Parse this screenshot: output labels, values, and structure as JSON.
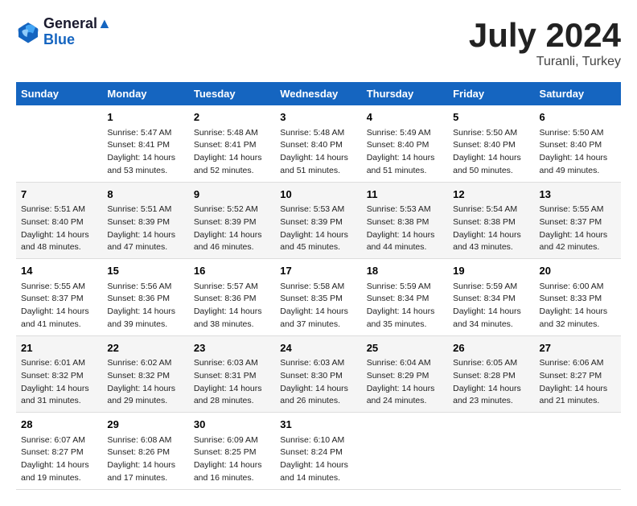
{
  "header": {
    "logo_line1": "General",
    "logo_line2": "Blue",
    "main_title": "July 2024",
    "subtitle": "Turanli, Turkey"
  },
  "columns": [
    "Sunday",
    "Monday",
    "Tuesday",
    "Wednesday",
    "Thursday",
    "Friday",
    "Saturday"
  ],
  "weeks": [
    [
      {
        "day": "",
        "sunrise": "",
        "sunset": "",
        "daylight": ""
      },
      {
        "day": "1",
        "sunrise": "Sunrise: 5:47 AM",
        "sunset": "Sunset: 8:41 PM",
        "daylight": "Daylight: 14 hours and 53 minutes."
      },
      {
        "day": "2",
        "sunrise": "Sunrise: 5:48 AM",
        "sunset": "Sunset: 8:41 PM",
        "daylight": "Daylight: 14 hours and 52 minutes."
      },
      {
        "day": "3",
        "sunrise": "Sunrise: 5:48 AM",
        "sunset": "Sunset: 8:40 PM",
        "daylight": "Daylight: 14 hours and 51 minutes."
      },
      {
        "day": "4",
        "sunrise": "Sunrise: 5:49 AM",
        "sunset": "Sunset: 8:40 PM",
        "daylight": "Daylight: 14 hours and 51 minutes."
      },
      {
        "day": "5",
        "sunrise": "Sunrise: 5:50 AM",
        "sunset": "Sunset: 8:40 PM",
        "daylight": "Daylight: 14 hours and 50 minutes."
      },
      {
        "day": "6",
        "sunrise": "Sunrise: 5:50 AM",
        "sunset": "Sunset: 8:40 PM",
        "daylight": "Daylight: 14 hours and 49 minutes."
      }
    ],
    [
      {
        "day": "7",
        "sunrise": "Sunrise: 5:51 AM",
        "sunset": "Sunset: 8:40 PM",
        "daylight": "Daylight: 14 hours and 48 minutes."
      },
      {
        "day": "8",
        "sunrise": "Sunrise: 5:51 AM",
        "sunset": "Sunset: 8:39 PM",
        "daylight": "Daylight: 14 hours and 47 minutes."
      },
      {
        "day": "9",
        "sunrise": "Sunrise: 5:52 AM",
        "sunset": "Sunset: 8:39 PM",
        "daylight": "Daylight: 14 hours and 46 minutes."
      },
      {
        "day": "10",
        "sunrise": "Sunrise: 5:53 AM",
        "sunset": "Sunset: 8:39 PM",
        "daylight": "Daylight: 14 hours and 45 minutes."
      },
      {
        "day": "11",
        "sunrise": "Sunrise: 5:53 AM",
        "sunset": "Sunset: 8:38 PM",
        "daylight": "Daylight: 14 hours and 44 minutes."
      },
      {
        "day": "12",
        "sunrise": "Sunrise: 5:54 AM",
        "sunset": "Sunset: 8:38 PM",
        "daylight": "Daylight: 14 hours and 43 minutes."
      },
      {
        "day": "13",
        "sunrise": "Sunrise: 5:55 AM",
        "sunset": "Sunset: 8:37 PM",
        "daylight": "Daylight: 14 hours and 42 minutes."
      }
    ],
    [
      {
        "day": "14",
        "sunrise": "Sunrise: 5:55 AM",
        "sunset": "Sunset: 8:37 PM",
        "daylight": "Daylight: 14 hours and 41 minutes."
      },
      {
        "day": "15",
        "sunrise": "Sunrise: 5:56 AM",
        "sunset": "Sunset: 8:36 PM",
        "daylight": "Daylight: 14 hours and 39 minutes."
      },
      {
        "day": "16",
        "sunrise": "Sunrise: 5:57 AM",
        "sunset": "Sunset: 8:36 PM",
        "daylight": "Daylight: 14 hours and 38 minutes."
      },
      {
        "day": "17",
        "sunrise": "Sunrise: 5:58 AM",
        "sunset": "Sunset: 8:35 PM",
        "daylight": "Daylight: 14 hours and 37 minutes."
      },
      {
        "day": "18",
        "sunrise": "Sunrise: 5:59 AM",
        "sunset": "Sunset: 8:34 PM",
        "daylight": "Daylight: 14 hours and 35 minutes."
      },
      {
        "day": "19",
        "sunrise": "Sunrise: 5:59 AM",
        "sunset": "Sunset: 8:34 PM",
        "daylight": "Daylight: 14 hours and 34 minutes."
      },
      {
        "day": "20",
        "sunrise": "Sunrise: 6:00 AM",
        "sunset": "Sunset: 8:33 PM",
        "daylight": "Daylight: 14 hours and 32 minutes."
      }
    ],
    [
      {
        "day": "21",
        "sunrise": "Sunrise: 6:01 AM",
        "sunset": "Sunset: 8:32 PM",
        "daylight": "Daylight: 14 hours and 31 minutes."
      },
      {
        "day": "22",
        "sunrise": "Sunrise: 6:02 AM",
        "sunset": "Sunset: 8:32 PM",
        "daylight": "Daylight: 14 hours and 29 minutes."
      },
      {
        "day": "23",
        "sunrise": "Sunrise: 6:03 AM",
        "sunset": "Sunset: 8:31 PM",
        "daylight": "Daylight: 14 hours and 28 minutes."
      },
      {
        "day": "24",
        "sunrise": "Sunrise: 6:03 AM",
        "sunset": "Sunset: 8:30 PM",
        "daylight": "Daylight: 14 hours and 26 minutes."
      },
      {
        "day": "25",
        "sunrise": "Sunrise: 6:04 AM",
        "sunset": "Sunset: 8:29 PM",
        "daylight": "Daylight: 14 hours and 24 minutes."
      },
      {
        "day": "26",
        "sunrise": "Sunrise: 6:05 AM",
        "sunset": "Sunset: 8:28 PM",
        "daylight": "Daylight: 14 hours and 23 minutes."
      },
      {
        "day": "27",
        "sunrise": "Sunrise: 6:06 AM",
        "sunset": "Sunset: 8:27 PM",
        "daylight": "Daylight: 14 hours and 21 minutes."
      }
    ],
    [
      {
        "day": "28",
        "sunrise": "Sunrise: 6:07 AM",
        "sunset": "Sunset: 8:27 PM",
        "daylight": "Daylight: 14 hours and 19 minutes."
      },
      {
        "day": "29",
        "sunrise": "Sunrise: 6:08 AM",
        "sunset": "Sunset: 8:26 PM",
        "daylight": "Daylight: 14 hours and 17 minutes."
      },
      {
        "day": "30",
        "sunrise": "Sunrise: 6:09 AM",
        "sunset": "Sunset: 8:25 PM",
        "daylight": "Daylight: 14 hours and 16 minutes."
      },
      {
        "day": "31",
        "sunrise": "Sunrise: 6:10 AM",
        "sunset": "Sunset: 8:24 PM",
        "daylight": "Daylight: 14 hours and 14 minutes."
      },
      {
        "day": "",
        "sunrise": "",
        "sunset": "",
        "daylight": ""
      },
      {
        "day": "",
        "sunrise": "",
        "sunset": "",
        "daylight": ""
      },
      {
        "day": "",
        "sunrise": "",
        "sunset": "",
        "daylight": ""
      }
    ]
  ]
}
